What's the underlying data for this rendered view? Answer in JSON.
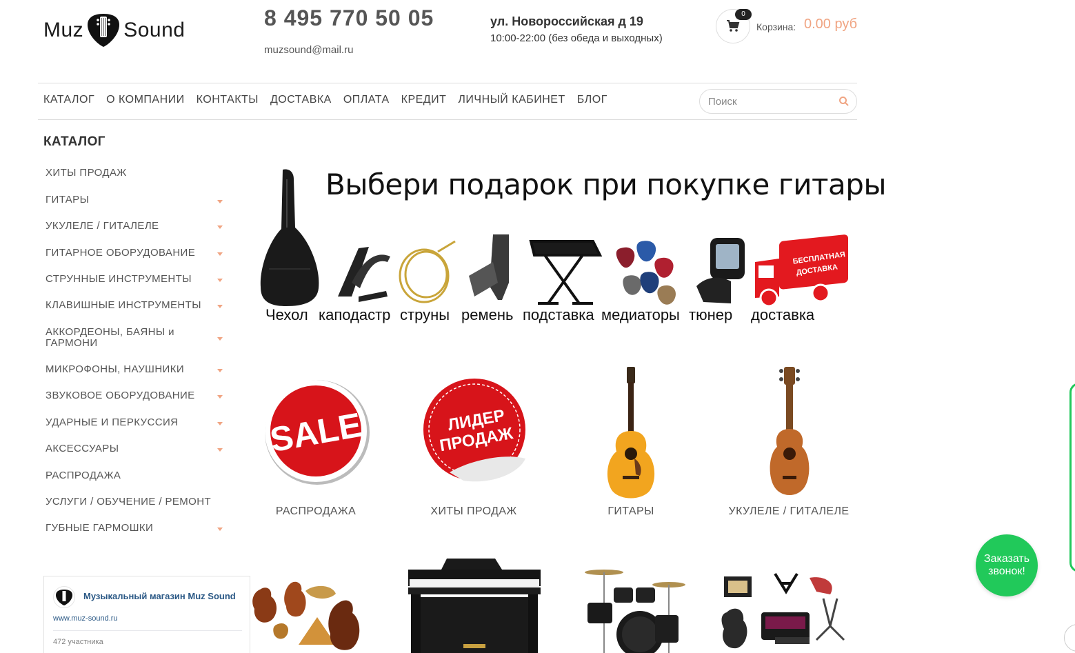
{
  "header": {
    "logo_left": "Muz",
    "logo_right": "Sound",
    "phone": "8 495 770 50 05",
    "email": "muzsound@mail.ru",
    "address": "ул. Новороссийская д 19",
    "hours": "10:00-22:00 (без обеда и выходных)",
    "cart_count": "0",
    "cart_label": "Корзина:",
    "cart_sum": "0.00 руб"
  },
  "nav": {
    "items": [
      "КАТАЛОГ",
      "О КОМПАНИИ",
      "КОНТАКТЫ",
      "ДОСТАВКА",
      "ОПЛАТА",
      "КРЕДИТ",
      "ЛИЧНЫЙ КАБИНЕТ",
      "БЛОГ"
    ],
    "search_placeholder": "Поиск"
  },
  "sidebar": {
    "title": "КАТАЛОГ",
    "items": [
      {
        "label": "ХИТЫ ПРОДАЖ",
        "has_children": false
      },
      {
        "label": "ГИТАРЫ",
        "has_children": true
      },
      {
        "label": "УКУЛЕЛЕ / ГИТАЛЕЛЕ",
        "has_children": true
      },
      {
        "label": "ГИТАРНОЕ ОБОРУДОВАНИЕ",
        "has_children": true
      },
      {
        "label": "СТРУННЫЕ ИНСТРУМЕНТЫ",
        "has_children": true
      },
      {
        "label": "КЛАВИШНЫЕ ИНСТРУМЕНТЫ",
        "has_children": true
      },
      {
        "label": "АККОРДЕОНЫ, БАЯНЫ и ГАРМОНИ",
        "has_children": true
      },
      {
        "label": "МИКРОФОНЫ, НАУШНИКИ",
        "has_children": true
      },
      {
        "label": "ЗВУКОВОЕ ОБОРУДОВАНИЕ",
        "has_children": true
      },
      {
        "label": "УДАРНЫЕ И ПЕРКУССИЯ",
        "has_children": true
      },
      {
        "label": "АКСЕССУАРЫ",
        "has_children": true
      },
      {
        "label": "РАСПРОДАЖА",
        "has_children": false
      },
      {
        "label": "УСЛУГИ / ОБУЧЕНИЕ / РЕМОНТ",
        "has_children": false
      },
      {
        "label": "ГУБНЫЕ ГАРМОШКИ",
        "has_children": true
      }
    ],
    "vk_widget": {
      "name": "Музыкальный магазин Muz Sound",
      "url": "www.muz-sound.ru",
      "members": "472 участника"
    }
  },
  "banner": {
    "title": "Выбери подарок при покупке гитары",
    "gifts": [
      "Чехол",
      "каподастр",
      "струны",
      "ремень",
      "подставка",
      "медиаторы",
      "тюнер",
      "доставка"
    ],
    "truck_text_1": "БЕСПЛАТНАЯ",
    "truck_text_2": "ДОСТАВКА"
  },
  "tiles": {
    "row1": [
      "РАСПРОДАЖА",
      "ХИТЫ ПРОДАЖ",
      "ГИТАРЫ",
      "УКУЛЕЛЕ / ГИТАЛЕЛЕ"
    ],
    "sale_badge": "SALE",
    "leader_badge_1": "ЛИДЕР",
    "leader_badge_2": "ПРОДАЖ"
  },
  "callback": {
    "label_1": "Заказать",
    "label_2": "звонок!"
  },
  "colors": {
    "accent": "#f0a482",
    "callback_green": "#21c95a",
    "sale_red": "#d7141a"
  }
}
